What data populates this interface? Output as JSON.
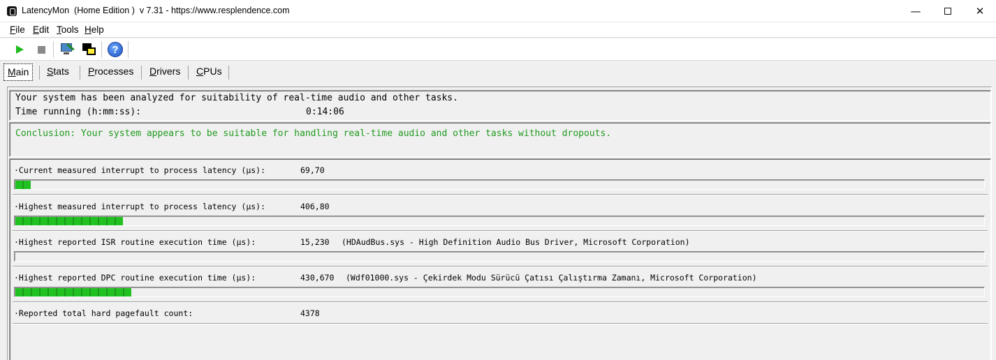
{
  "window": {
    "title": "LatencyMon  (Home Edition )  v 7.31 - https://www.resplendence.com",
    "minimize": "—",
    "close": "✕"
  },
  "menu": [
    {
      "label": "File"
    },
    {
      "label": "Edit"
    },
    {
      "label": "Tools"
    },
    {
      "label": "Help"
    }
  ],
  "toolbar": {
    "icons": [
      "play-icon",
      "stop-icon",
      "monitor-wand-icon",
      "windows-icon",
      "help-icon"
    ],
    "help_glyph": "?"
  },
  "tabs": [
    {
      "label": "Main",
      "active": true
    },
    {
      "label": "Stats",
      "active": false
    },
    {
      "label": "Processes",
      "active": false
    },
    {
      "label": "Drivers",
      "active": false
    },
    {
      "label": "CPUs",
      "active": false
    }
  ],
  "summary": {
    "line1": "Your system has been analyzed for suitability of real-time audio and other tasks.",
    "time_label": "Time running (h:mm:ss):",
    "time_value": "0:14:06",
    "conclusion": "Conclusion: Your system appears to be suitable for handling real-time audio and other tasks without dropouts."
  },
  "metrics": [
    {
      "label": "·Current measured interrupt to process latency (µs):",
      "value": "69,70",
      "extra": "",
      "gauge_fraction": 0.017
    },
    {
      "label": "·Highest measured interrupt to process latency (µs):",
      "value": "406,80",
      "extra": "",
      "gauge_fraction": 0.111
    },
    {
      "label": "·Highest reported ISR routine execution time (µs):",
      "value": "15,230",
      "extra": "(HDAudBus.sys - High Definition Audio Bus Driver, Microsoft Corporation)",
      "gauge_fraction": 0.0
    },
    {
      "label": "·Highest reported DPC routine execution time (µs):",
      "value": "430,670",
      "extra": "(Wdf01000.sys - Çekirdek Modu Sürücü Çatısı Çalıştırma Zamanı, Microsoft Corporation)",
      "gauge_fraction": 0.12
    },
    {
      "label": "·Reported total hard pagefault count:",
      "value": "4378",
      "extra": "",
      "gauge_fraction": 0.0
    }
  ],
  "colors": {
    "gauge_green": "#22c122",
    "conclusion_green": "#1e9a1e"
  }
}
